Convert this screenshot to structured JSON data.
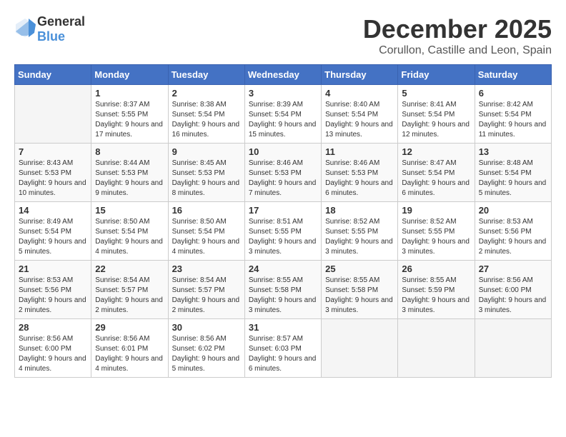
{
  "logo": {
    "general": "General",
    "blue": "Blue"
  },
  "header": {
    "month": "December 2025",
    "location": "Corullon, Castille and Leon, Spain"
  },
  "weekdays": [
    "Sunday",
    "Monday",
    "Tuesday",
    "Wednesday",
    "Thursday",
    "Friday",
    "Saturday"
  ],
  "weeks": [
    [
      {
        "day": "",
        "sunrise": "",
        "sunset": "",
        "daylight": ""
      },
      {
        "day": "1",
        "sunrise": "Sunrise: 8:37 AM",
        "sunset": "Sunset: 5:55 PM",
        "daylight": "Daylight: 9 hours and 17 minutes."
      },
      {
        "day": "2",
        "sunrise": "Sunrise: 8:38 AM",
        "sunset": "Sunset: 5:54 PM",
        "daylight": "Daylight: 9 hours and 16 minutes."
      },
      {
        "day": "3",
        "sunrise": "Sunrise: 8:39 AM",
        "sunset": "Sunset: 5:54 PM",
        "daylight": "Daylight: 9 hours and 15 minutes."
      },
      {
        "day": "4",
        "sunrise": "Sunrise: 8:40 AM",
        "sunset": "Sunset: 5:54 PM",
        "daylight": "Daylight: 9 hours and 13 minutes."
      },
      {
        "day": "5",
        "sunrise": "Sunrise: 8:41 AM",
        "sunset": "Sunset: 5:54 PM",
        "daylight": "Daylight: 9 hours and 12 minutes."
      },
      {
        "day": "6",
        "sunrise": "Sunrise: 8:42 AM",
        "sunset": "Sunset: 5:54 PM",
        "daylight": "Daylight: 9 hours and 11 minutes."
      }
    ],
    [
      {
        "day": "7",
        "sunrise": "Sunrise: 8:43 AM",
        "sunset": "Sunset: 5:53 PM",
        "daylight": "Daylight: 9 hours and 10 minutes."
      },
      {
        "day": "8",
        "sunrise": "Sunrise: 8:44 AM",
        "sunset": "Sunset: 5:53 PM",
        "daylight": "Daylight: 9 hours and 9 minutes."
      },
      {
        "day": "9",
        "sunrise": "Sunrise: 8:45 AM",
        "sunset": "Sunset: 5:53 PM",
        "daylight": "Daylight: 9 hours and 8 minutes."
      },
      {
        "day": "10",
        "sunrise": "Sunrise: 8:46 AM",
        "sunset": "Sunset: 5:53 PM",
        "daylight": "Daylight: 9 hours and 7 minutes."
      },
      {
        "day": "11",
        "sunrise": "Sunrise: 8:46 AM",
        "sunset": "Sunset: 5:53 PM",
        "daylight": "Daylight: 9 hours and 6 minutes."
      },
      {
        "day": "12",
        "sunrise": "Sunrise: 8:47 AM",
        "sunset": "Sunset: 5:54 PM",
        "daylight": "Daylight: 9 hours and 6 minutes."
      },
      {
        "day": "13",
        "sunrise": "Sunrise: 8:48 AM",
        "sunset": "Sunset: 5:54 PM",
        "daylight": "Daylight: 9 hours and 5 minutes."
      }
    ],
    [
      {
        "day": "14",
        "sunrise": "Sunrise: 8:49 AM",
        "sunset": "Sunset: 5:54 PM",
        "daylight": "Daylight: 9 hours and 5 minutes."
      },
      {
        "day": "15",
        "sunrise": "Sunrise: 8:50 AM",
        "sunset": "Sunset: 5:54 PM",
        "daylight": "Daylight: 9 hours and 4 minutes."
      },
      {
        "day": "16",
        "sunrise": "Sunrise: 8:50 AM",
        "sunset": "Sunset: 5:54 PM",
        "daylight": "Daylight: 9 hours and 4 minutes."
      },
      {
        "day": "17",
        "sunrise": "Sunrise: 8:51 AM",
        "sunset": "Sunset: 5:55 PM",
        "daylight": "Daylight: 9 hours and 3 minutes."
      },
      {
        "day": "18",
        "sunrise": "Sunrise: 8:52 AM",
        "sunset": "Sunset: 5:55 PM",
        "daylight": "Daylight: 9 hours and 3 minutes."
      },
      {
        "day": "19",
        "sunrise": "Sunrise: 8:52 AM",
        "sunset": "Sunset: 5:55 PM",
        "daylight": "Daylight: 9 hours and 3 minutes."
      },
      {
        "day": "20",
        "sunrise": "Sunrise: 8:53 AM",
        "sunset": "Sunset: 5:56 PM",
        "daylight": "Daylight: 9 hours and 2 minutes."
      }
    ],
    [
      {
        "day": "21",
        "sunrise": "Sunrise: 8:53 AM",
        "sunset": "Sunset: 5:56 PM",
        "daylight": "Daylight: 9 hours and 2 minutes."
      },
      {
        "day": "22",
        "sunrise": "Sunrise: 8:54 AM",
        "sunset": "Sunset: 5:57 PM",
        "daylight": "Daylight: 9 hours and 2 minutes."
      },
      {
        "day": "23",
        "sunrise": "Sunrise: 8:54 AM",
        "sunset": "Sunset: 5:57 PM",
        "daylight": "Daylight: 9 hours and 2 minutes."
      },
      {
        "day": "24",
        "sunrise": "Sunrise: 8:55 AM",
        "sunset": "Sunset: 5:58 PM",
        "daylight": "Daylight: 9 hours and 3 minutes."
      },
      {
        "day": "25",
        "sunrise": "Sunrise: 8:55 AM",
        "sunset": "Sunset: 5:58 PM",
        "daylight": "Daylight: 9 hours and 3 minutes."
      },
      {
        "day": "26",
        "sunrise": "Sunrise: 8:55 AM",
        "sunset": "Sunset: 5:59 PM",
        "daylight": "Daylight: 9 hours and 3 minutes."
      },
      {
        "day": "27",
        "sunrise": "Sunrise: 8:56 AM",
        "sunset": "Sunset: 6:00 PM",
        "daylight": "Daylight: 9 hours and 3 minutes."
      }
    ],
    [
      {
        "day": "28",
        "sunrise": "Sunrise: 8:56 AM",
        "sunset": "Sunset: 6:00 PM",
        "daylight": "Daylight: 9 hours and 4 minutes."
      },
      {
        "day": "29",
        "sunrise": "Sunrise: 8:56 AM",
        "sunset": "Sunset: 6:01 PM",
        "daylight": "Daylight: 9 hours and 4 minutes."
      },
      {
        "day": "30",
        "sunrise": "Sunrise: 8:56 AM",
        "sunset": "Sunset: 6:02 PM",
        "daylight": "Daylight: 9 hours and 5 minutes."
      },
      {
        "day": "31",
        "sunrise": "Sunrise: 8:57 AM",
        "sunset": "Sunset: 6:03 PM",
        "daylight": "Daylight: 9 hours and 6 minutes."
      },
      {
        "day": "",
        "sunrise": "",
        "sunset": "",
        "daylight": ""
      },
      {
        "day": "",
        "sunrise": "",
        "sunset": "",
        "daylight": ""
      },
      {
        "day": "",
        "sunrise": "",
        "sunset": "",
        "daylight": ""
      }
    ]
  ]
}
